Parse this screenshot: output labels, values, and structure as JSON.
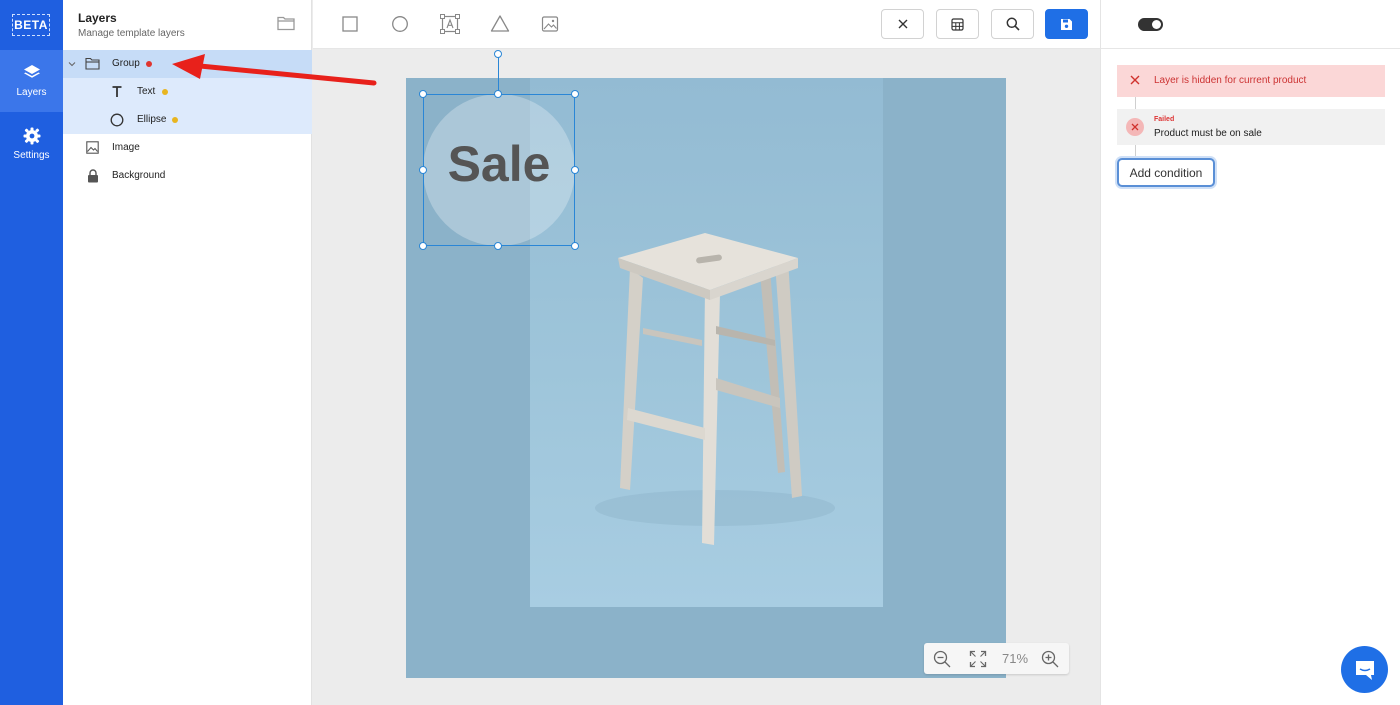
{
  "rail": {
    "badge": "BETA",
    "items": [
      {
        "label": "Layers",
        "icon": "layers-icon",
        "active": true
      },
      {
        "label": "Settings",
        "icon": "gear-icon",
        "active": false
      }
    ]
  },
  "layers_panel": {
    "title": "Layers",
    "subtitle": "Manage template layers",
    "items": [
      {
        "label": "Group",
        "icon": "folder-icon",
        "dot_color": "#e0342f"
      },
      {
        "label": "Text",
        "icon": "text-icon",
        "dot_color": "#e8b520"
      },
      {
        "label": "Ellipse",
        "icon": "ellipse-icon",
        "dot_color": "#e8b520"
      },
      {
        "label": "Image",
        "icon": "image-icon"
      },
      {
        "label": "Background",
        "icon": "lock-icon"
      }
    ]
  },
  "toolbar": {
    "tools": [
      "rectangle-icon",
      "ellipse-icon",
      "text-frame-icon",
      "triangle-icon",
      "image-icon"
    ],
    "buttons": [
      "close-icon",
      "table-icon",
      "search-icon",
      "save-icon"
    ]
  },
  "canvas": {
    "sale_text": "Sale",
    "zoom_value": "71%"
  },
  "conditions": {
    "alert_text": "Layer is hidden for current product",
    "condition_status": "Failed",
    "condition_text": "Product must be on sale",
    "add_button": "Add condition"
  },
  "colors": {
    "accent": "#1f5fe0",
    "primary_button": "#1f6fe6",
    "alert_bg": "#fbd7d7",
    "selection": "#2a86d6"
  }
}
